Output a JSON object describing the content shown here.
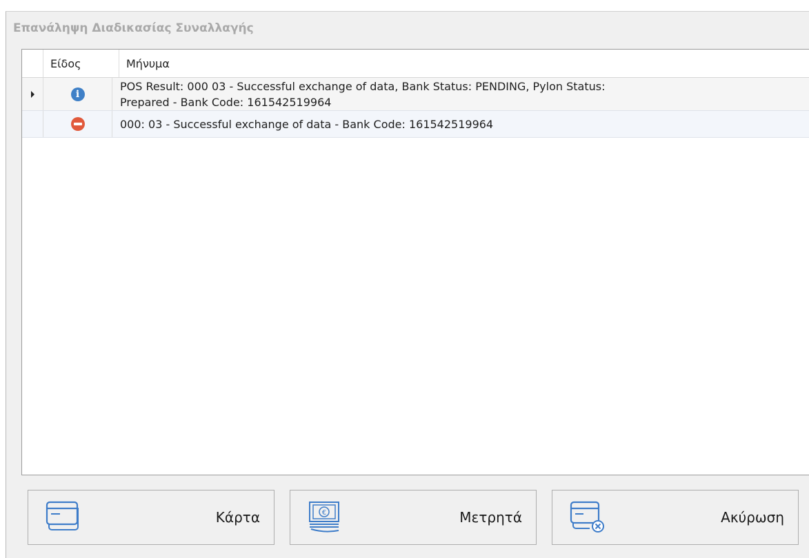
{
  "window": {
    "title": "Επανάληψη Διαδικασίας Συναλλαγής"
  },
  "grid": {
    "columns": [
      "Είδος",
      "Μήνυμα"
    ],
    "rows": [
      {
        "type_icon": "info-icon",
        "selected": true,
        "message_line1": "POS Result: 000 03 - Successful exchange of data, Bank Status: PENDING, Pylon Status:",
        "message_line2": "Prepared - Bank Code: 161542519964"
      },
      {
        "type_icon": "error-icon",
        "selected": false,
        "message_line1": "000: 03 - Successful exchange of data - Bank Code: 161542519964"
      }
    ]
  },
  "buttons": {
    "card": {
      "label": "Κάρτα",
      "icon": "credit-card-icon"
    },
    "cash": {
      "label": "Μετρητά",
      "icon": "cash-euro-icon"
    },
    "cancel": {
      "label": "Ακύρωση",
      "icon": "card-cancel-icon"
    }
  },
  "colors": {
    "info": "#3f80c7",
    "error": "#e15a3c",
    "icon_line": "#3d7cc9"
  }
}
